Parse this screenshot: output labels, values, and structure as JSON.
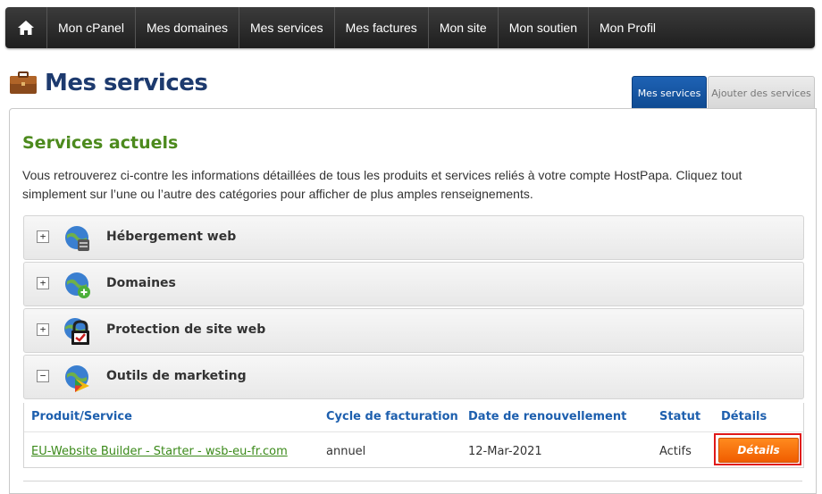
{
  "nav": {
    "items": [
      {
        "label": "Mon cPanel"
      },
      {
        "label": "Mes domaines"
      },
      {
        "label": "Mes services"
      },
      {
        "label": "Mes factures"
      },
      {
        "label": "Mon site"
      },
      {
        "label": "Mon soutien"
      },
      {
        "label": "Mon Profil"
      }
    ]
  },
  "page": {
    "title": "Mes services"
  },
  "tabs": {
    "active": "Mes services",
    "inactive": "Ajouter des services"
  },
  "section": {
    "title": "Services actuels",
    "description": "Vous retrouverez ci-contre les informations détaillées de tous les produits et services reliés à votre compte HostPapa. Cliquez tout simplement sur l’une ou l’autre des catégories pour afficher de plus amples renseignements."
  },
  "accordions": [
    {
      "label": "Hébergement web",
      "toggle": "+",
      "icon": "globe-server-icon"
    },
    {
      "label": "Domaines",
      "toggle": "+",
      "icon": "globe-plus-icon"
    },
    {
      "label": "Protection de site web",
      "toggle": "+",
      "icon": "padlock-check-icon"
    },
    {
      "label": "Outils de marketing",
      "toggle": "−",
      "icon": "globe-marketing-icon"
    }
  ],
  "table": {
    "headers": [
      "Produit/Service",
      "Cycle de facturation",
      "Date de renouvellement",
      "Statut",
      "Détails"
    ],
    "rows": [
      {
        "service": "EU-Website Builder - Starter - wsb-eu-fr.com",
        "cycle": "annuel",
        "renewal": "12-Mar-2021",
        "status": "Actifs",
        "details_label": "Détails"
      }
    ]
  },
  "colors": {
    "nav_bg": "#2b2b2b",
    "title": "#1d3a6e",
    "section_title": "#4c8a1d",
    "header_link": "#1d5fae",
    "details_button": "#f57200",
    "highlight": "#e01919"
  }
}
